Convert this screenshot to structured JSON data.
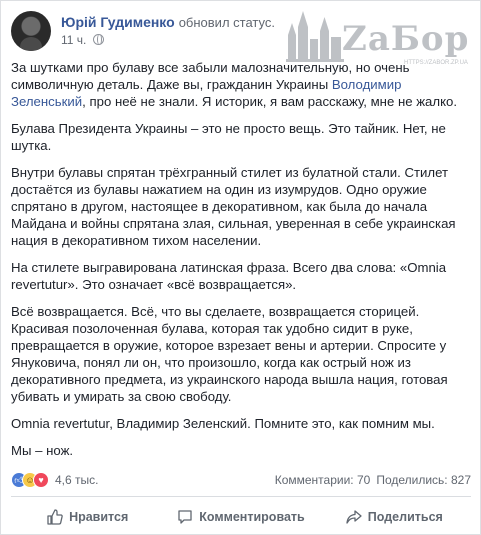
{
  "post": {
    "author": "Юрій Гудименко",
    "action": "обновил статус.",
    "time": "11 ч."
  },
  "watermark": {
    "text": "ZаБор",
    "sub": "HTTPS://ZABOR.ZP.UA"
  },
  "body": {
    "p1_before": "За шутками про булаву все забыли малозначительную, но очень символичную деталь. Даже вы, гражданин Украины ",
    "p1_mention": "Володимир Зеленський",
    "p1_after": ", про неё не знали. Я историк, я вам расскажу, мне не жалко.",
    "p2": "Булава Президента Украины – это не просто вещь. Это тайник. Нет, не шутка.",
    "p3": "Внутри булавы спрятан трёхгранный стилет из булатной стали. Стилет достаётся из булавы нажатием на один из изумрудов. Одно оружие спрятано в другом, настоящее в декоративном, как была до начала Майдана и войны спрятана злая, сильная, уверенная в себе украинская нация в декоративном тихом населении.",
    "p4": "На стилете выгравирована латинская фраза. Всего два слова: «Omnia revertutur». Это означает «всё возвращается».",
    "p5": "Всё возвращается. Всё, что вы сделаете, возвращается сторицей. Красивая позолоченная булава, которая так удобно сидит в руке, превращается в оружие, которое взрезает вены и артерии. Спросите у Януковича, понял ли он, что произошло, когда как острый нож из декоративного предмета, из украинского народа вышла нация, готовая убивать и умирать за свою свободу.",
    "p6": "Omnia revertutur, Владимир Зеленский. Помните это, как помним мы.",
    "p7": "Мы – нож."
  },
  "reactions": {
    "icons": [
      "like-icon",
      "haha-icon",
      "love-icon"
    ],
    "count": "4,6 тыс."
  },
  "stats": {
    "comments": "Комментарии: 70",
    "shares": "Поделились: 827"
  },
  "actions": {
    "like": "Нравится",
    "comment": "Комментировать",
    "share": "Поделиться"
  },
  "colors": {
    "link": "#385898",
    "text": "#1d2129",
    "muted": "#616770"
  }
}
